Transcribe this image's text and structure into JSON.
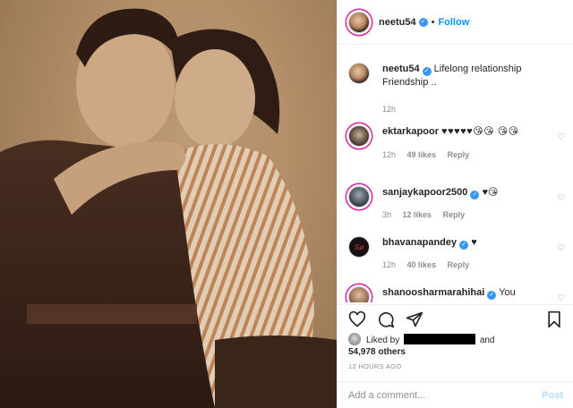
{
  "post": {
    "author": "neetu54",
    "follow_label": "Follow",
    "dot": "•"
  },
  "caption": {
    "user": "neetu54",
    "text": "Lifelong relationship Friendship ..",
    "time": "12h"
  },
  "comments": [
    {
      "user": "ektarkapoor",
      "text": "♥♥♥♥♥😘😘 😘😘",
      "time": "12h",
      "likes": "49 likes",
      "reply": "Reply"
    },
    {
      "user": "sanjaykapoor2500",
      "text": "♥😘",
      "time": "3h",
      "likes": "12 likes",
      "reply": "Reply"
    },
    {
      "user": "bhavanapandey",
      "text": "♥",
      "time": "12h",
      "likes": "40 likes",
      "reply": "Reply"
    },
    {
      "user": "shanoosharmarahihai",
      "text": "You",
      "time": "",
      "likes": "",
      "reply": ""
    }
  ],
  "likes": {
    "prefix": "Liked by",
    "suffix": "and",
    "count": "54,978 others"
  },
  "timestamp": "12 HOURS AGO",
  "add_comment": {
    "placeholder": "Add a comment...",
    "post_label": "Post"
  },
  "avatar_labels": {
    "bhavana": "Sø"
  },
  "icons": {
    "like": "heart-icon",
    "comment": "comment-icon",
    "share": "paper-plane-icon",
    "save": "bookmark-icon",
    "verified": "verified-badge-icon",
    "comment_like": "small-heart-icon"
  },
  "colors": {
    "accent": "#0095f6",
    "verified": "#3897f0",
    "meta_grey": "#8e8e8e",
    "post_disabled": "#b2dffc"
  }
}
